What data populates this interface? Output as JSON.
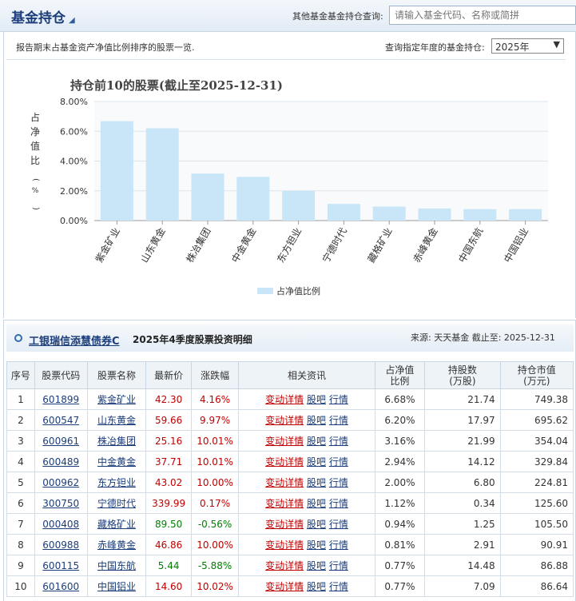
{
  "header": {
    "title": "基金持仓",
    "query_label": "其他基金基金持仓查询:",
    "query_placeholder": "请输入基金代码、名称或简拼"
  },
  "filter": {
    "description": "报告期末占基金资产净值比例排序的股票一览.",
    "year_label": "查询指定年度的基金持仓:",
    "year_value": "2025年"
  },
  "chart_data": {
    "type": "bar",
    "title": "持仓前10的股票(截止至2025-12-31)",
    "ylabel": "占净值比(%)",
    "ylim": [
      0,
      8
    ],
    "yticks": [
      "0.00%",
      "2.00%",
      "4.00%",
      "6.00%",
      "8.00%"
    ],
    "categories": [
      "紫金矿业",
      "山东黄金",
      "株冶集团",
      "中金黄金",
      "东方钽业",
      "宁德时代",
      "藏格矿业",
      "赤峰黄金",
      "中国东航",
      "中国铝业"
    ],
    "values": [
      6.68,
      6.2,
      3.16,
      2.94,
      2.0,
      1.12,
      0.94,
      0.81,
      0.77,
      0.77
    ],
    "legend": "占净值比例",
    "legend_position": "bottom",
    "bar_color": "#c8e6f8"
  },
  "detail": {
    "fund_name": "工银瑞信添慧债券C",
    "title": "2025年4季度股票投资明细",
    "source": "来源: 天天基金    截止至: 2025-12-31",
    "columns": [
      "序号",
      "股票代码",
      "股票名称",
      "最新价",
      "涨跌幅",
      "相关资讯",
      "占净值比例",
      "持股数(万股)",
      "持仓市值(万元)"
    ],
    "link_labels": [
      "变动详情",
      "股吧",
      "行情"
    ],
    "rows": [
      {
        "no": "1",
        "code": "601899",
        "name": "紫金矿业",
        "price": "42.30",
        "change": "4.16%",
        "dir": "up",
        "ratio": "6.68%",
        "shares": "21.74",
        "value": "749.38"
      },
      {
        "no": "2",
        "code": "600547",
        "name": "山东黄金",
        "price": "59.66",
        "change": "9.97%",
        "dir": "up",
        "ratio": "6.20%",
        "shares": "17.97",
        "value": "695.62"
      },
      {
        "no": "3",
        "code": "600961",
        "name": "株冶集团",
        "price": "25.16",
        "change": "10.01%",
        "dir": "up",
        "ratio": "3.16%",
        "shares": "21.99",
        "value": "354.04"
      },
      {
        "no": "4",
        "code": "600489",
        "name": "中金黄金",
        "price": "37.71",
        "change": "10.01%",
        "dir": "up",
        "ratio": "2.94%",
        "shares": "14.12",
        "value": "329.84"
      },
      {
        "no": "5",
        "code": "000962",
        "name": "东方钽业",
        "price": "43.02",
        "change": "10.00%",
        "dir": "up",
        "ratio": "2.00%",
        "shares": "6.80",
        "value": "224.81"
      },
      {
        "no": "6",
        "code": "300750",
        "name": "宁德时代",
        "price": "339.99",
        "change": "0.17%",
        "dir": "up",
        "ratio": "1.12%",
        "shares": "0.34",
        "value": "125.60"
      },
      {
        "no": "7",
        "code": "000408",
        "name": "藏格矿业",
        "price": "89.50",
        "change": "-0.56%",
        "dir": "down",
        "ratio": "0.94%",
        "shares": "1.25",
        "value": "105.50"
      },
      {
        "no": "8",
        "code": "600988",
        "name": "赤峰黄金",
        "price": "46.86",
        "change": "10.00%",
        "dir": "up",
        "ratio": "0.81%",
        "shares": "2.91",
        "value": "90.91"
      },
      {
        "no": "9",
        "code": "600115",
        "name": "中国东航",
        "price": "5.44",
        "change": "-5.88%",
        "dir": "down",
        "ratio": "0.77%",
        "shares": "14.48",
        "value": "86.88"
      },
      {
        "no": "10",
        "code": "601600",
        "name": "中国铝业",
        "price": "14.60",
        "change": "10.02%",
        "dir": "up",
        "ratio": "0.77%",
        "shares": "7.09",
        "value": "86.64"
      }
    ]
  }
}
